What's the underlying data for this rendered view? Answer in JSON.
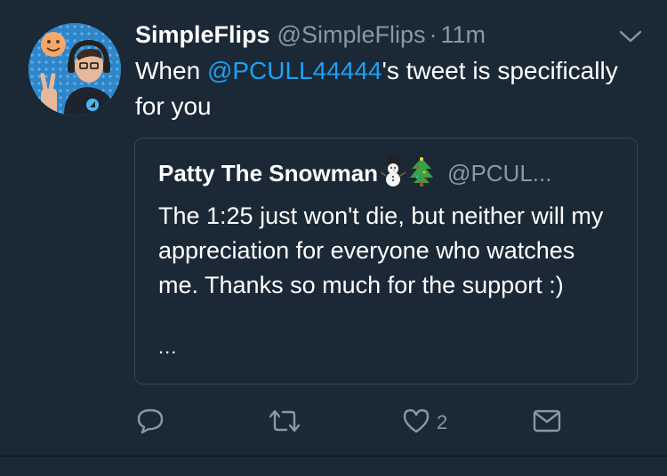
{
  "tweet": {
    "author_name": "SimpleFlips",
    "author_handle": "@SimpleFlips",
    "separator": "·",
    "time": "11m",
    "text_before": "When ",
    "mention": "@PCULL44444",
    "text_after": "'s tweet is specifically for you"
  },
  "quote": {
    "author_name": "Patty The Snowman",
    "emojis": [
      "snowman-emoji",
      "christmas-tree-emoji"
    ],
    "author_handle": "@PCUL...",
    "text": "The 1:25 just won't die, but neither will my appreciation for everyone who watches me. Thanks so much for the support :)",
    "ellipsis": "..."
  },
  "actions": {
    "reply_icon": "reply-icon",
    "retweet_icon": "retweet-icon",
    "like_icon": "heart-icon",
    "like_count": "2",
    "dm_icon": "envelope-icon"
  },
  "colors": {
    "background": "#1b2836",
    "accent": "#1da1f2",
    "secondary_text": "#8899a6",
    "border": "#38444d"
  }
}
